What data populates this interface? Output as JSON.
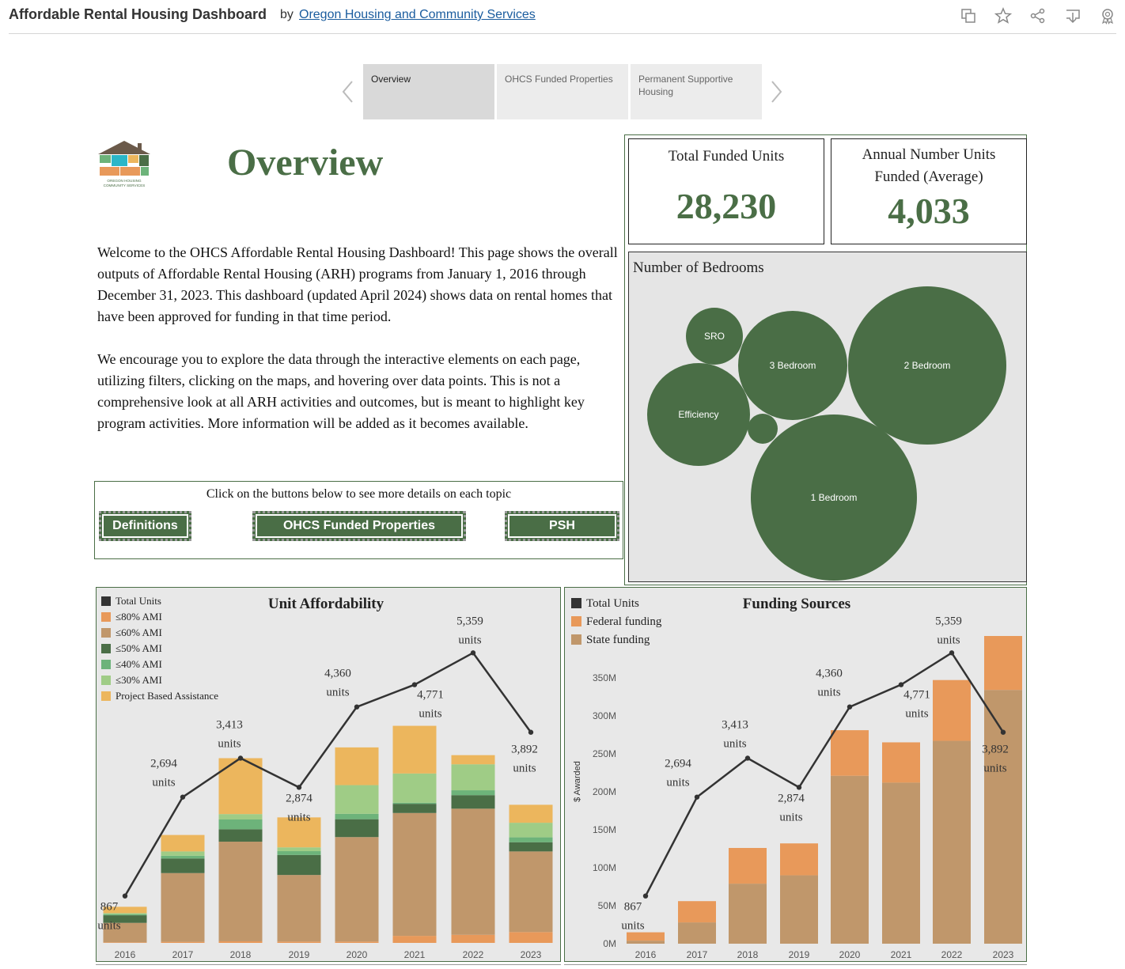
{
  "topbar": {
    "title": "Affordable Rental Housing Dashboard",
    "by": "by",
    "org": "Oregon Housing and Community Services",
    "icons": [
      "copy-icon",
      "favorite-star-icon",
      "share-icon",
      "download-icon",
      "badge-icon"
    ]
  },
  "tabs": [
    {
      "label": "Overview",
      "active": true
    },
    {
      "label": "OHCS Funded Properties",
      "active": false
    },
    {
      "label": "Permanent Supportive Housing",
      "active": false
    }
  ],
  "logo": {
    "line1": "OREGON HOUSING",
    "line1b": "and",
    "line2": "COMMUNITY SERVICES"
  },
  "page_title": "Overview",
  "intro": [
    "Welcome to the OHCS Affordable Rental Housing Dashboard! This page shows the overall outputs of Affordable Rental Housing (ARH) programs from January 1, 2016 through December 31, 2023. This dashboard (updated April 2024) shows data on rental homes that have been approved for funding in that time period.",
    "We encourage you to explore the data through the interactive elements on each page, utilizing filters, clicking on the maps, and hovering over data points. This is not a comprehensive look at all ARH activities and outcomes, but is meant to highlight key program activities. More information will be added as it becomes available."
  ],
  "buttons": {
    "caption": "Click on the buttons below to see more details on each topic",
    "definitions": "Definitions",
    "properties": "OHCS Funded Properties",
    "psh": "PSH"
  },
  "kpis": {
    "total_label": "Total Funded Units",
    "total_value": "28,230",
    "annual_label": "Annual Number Units Funded (Average)",
    "annual_value": "4,033"
  },
  "colors": {
    "green_dark": "#4a6e46",
    "ami80": "#e8995a",
    "ami60": "#c0976b",
    "ami50": "#4a6e46",
    "ami40": "#6db37a",
    "ami30": "#9fcc86",
    "pba": "#ecb65d",
    "federal": "#e8995a",
    "state": "#c0976b",
    "total": "#333333"
  },
  "bedrooms": {
    "title": "Number of Bedrooms",
    "bubbles": [
      "SRO",
      "3 Bedroom",
      "2 Bedroom",
      "Efficiency",
      "",
      "1 Bedroom"
    ]
  },
  "chart_data": [
    {
      "type": "bar",
      "title": "Unit Affordability",
      "stacked": true,
      "categories": [
        "2016",
        "2017",
        "2018",
        "2019",
        "2020",
        "2021",
        "2022",
        "2023"
      ],
      "series": [
        {
          "name": "≤80% AMI",
          "values": [
            10,
            20,
            30,
            25,
            25,
            130,
            150,
            200
          ]
        },
        {
          "name": "≤60% AMI",
          "values": [
            360,
            1270,
            1840,
            1230,
            1930,
            2270,
            2330,
            1490
          ]
        },
        {
          "name": "≤50% AMI",
          "values": [
            140,
            270,
            230,
            370,
            330,
            170,
            250,
            170
          ]
        },
        {
          "name": "≤40% AMI",
          "values": [
            20,
            50,
            180,
            70,
            100,
            20,
            90,
            90
          ]
        },
        {
          "name": "≤30% AMI",
          "values": [
            20,
            80,
            100,
            70,
            530,
            540,
            480,
            270
          ]
        },
        {
          "name": "Project Based Assistance",
          "values": [
            117,
            304,
            1033,
            554,
            697,
            881,
            169,
            332
          ]
        }
      ],
      "line": {
        "name": "Total Units",
        "values": [
          867,
          2694,
          3413,
          2874,
          4360,
          4771,
          5359,
          3892
        ]
      },
      "point_labels": [
        "867 units",
        "2,694 units",
        "3,413 units",
        "2,874 units",
        "4,360 units",
        "4,771 units",
        "5,359 units",
        "3,892 units"
      ],
      "ylim": [
        0,
        5700
      ]
    },
    {
      "type": "bar",
      "title": "Funding Sources",
      "stacked": true,
      "categories": [
        "2016",
        "2017",
        "2018",
        "2019",
        "2020",
        "2021",
        "2022",
        "2023"
      ],
      "series": [
        {
          "name": "State funding",
          "values": [
            4,
            28,
            79,
            90,
            221,
            212,
            267,
            334
          ]
        },
        {
          "name": "Federal funding",
          "values": [
            11,
            28,
            47,
            42,
            60,
            53,
            80,
            71
          ]
        }
      ],
      "line": {
        "name": "Total Units",
        "values": [
          867,
          2694,
          3413,
          2874,
          4360,
          4771,
          5359,
          3892
        ]
      },
      "point_labels": [
        "867 units",
        "2,694 units",
        "3,413 units",
        "2,874 units",
        "4,360 units",
        "4,771 units",
        "5,359 units",
        "3,892 units"
      ],
      "ylabel": "$ Awarded",
      "yticks": [
        "0M",
        "50M",
        "100M",
        "150M",
        "200M",
        "250M",
        "300M",
        "350M"
      ],
      "ylim": [
        0,
        405
      ]
    }
  ]
}
